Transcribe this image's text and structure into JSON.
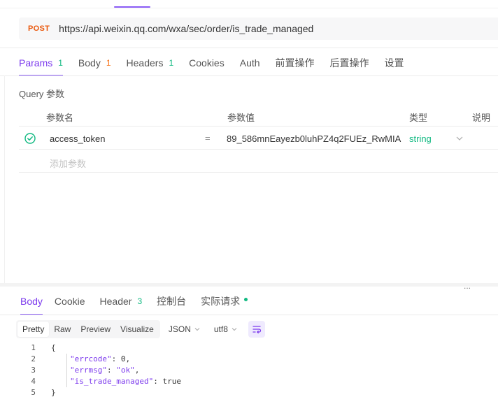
{
  "request": {
    "method": "POST",
    "url": "https://api.weixin.qq.com/wxa/sec/order/is_trade_managed"
  },
  "request_tabs": [
    {
      "label": "Params",
      "count": "1"
    },
    {
      "label": "Body",
      "count": "1"
    },
    {
      "label": "Headers",
      "count": "1"
    },
    {
      "label": "Cookies"
    },
    {
      "label": "Auth"
    },
    {
      "label": "前置操作"
    },
    {
      "label": "后置操作"
    },
    {
      "label": "设置"
    }
  ],
  "query": {
    "section_label": "Query 参数",
    "columns": [
      "参数名",
      "参数值",
      "类型",
      "说明"
    ],
    "rows": [
      {
        "name": "access_token",
        "eq": "=",
        "value": "89_586mnEayezb0luhPZ4q2FUEz_RwMIA",
        "type": "string"
      }
    ],
    "add_placeholder": "添加参数"
  },
  "split_handle": "...",
  "response_tabs": [
    {
      "label": "Body"
    },
    {
      "label": "Cookie"
    },
    {
      "label": "Header",
      "count": "3"
    },
    {
      "label": "控制台"
    },
    {
      "label": "实际请求"
    }
  ],
  "format": {
    "modes": [
      "Pretty",
      "Raw",
      "Preview",
      "Visualize"
    ],
    "language": "JSON",
    "encoding": "utf8"
  },
  "response_code": {
    "lines": [
      {
        "n": "1",
        "open": "{"
      },
      {
        "n": "2",
        "key": "\"errcode\"",
        "sep": ": ",
        "val": "0",
        "tail": ","
      },
      {
        "n": "3",
        "key": "\"errmsg\"",
        "sep": ": ",
        "val": "\"ok\"",
        "tail": ","
      },
      {
        "n": "4",
        "key": "\"is_trade_managed\"",
        "sep": ": ",
        "val": "true",
        "tail": ""
      },
      {
        "n": "5",
        "open": "}"
      }
    ]
  },
  "colors": {
    "accent": "#8b5cf6",
    "method": "#ea580c",
    "success": "#10b981",
    "count_orange": "#f97316"
  },
  "icons": {
    "check": "check-circle-icon",
    "chevron": "chevron-down-icon",
    "wrap": "word-wrap-icon",
    "dots": "more-dots-icon"
  }
}
